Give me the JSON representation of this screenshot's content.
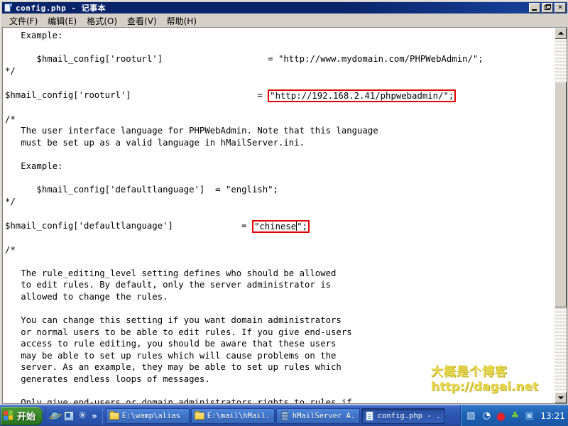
{
  "window": {
    "title": "config.php - 记事本",
    "icon": "notepad-document-icon",
    "minimize_label": "",
    "maximize_label": "",
    "close_label": "✕"
  },
  "menu": {
    "items": [
      {
        "label": "文件(F)",
        "name": "menu-file"
      },
      {
        "label": "编辑(E)",
        "name": "menu-edit"
      },
      {
        "label": "格式(O)",
        "name": "menu-format"
      },
      {
        "label": "查看(V)",
        "name": "menu-view"
      },
      {
        "label": "帮助(H)",
        "name": "menu-help"
      }
    ]
  },
  "editor": {
    "segment_1": "   Example:\n\n      $hmail_config['rooturl']                    = \"http://www.mydomain.com/PHPWebAdmin/\";\n*/\n\n$hmail_config['rooturl']                        = ",
    "highlight_1": "\"http://192.168.2.41/phpwebadmin/\";",
    "segment_2": "\n\n/*\n   The user interface language for PHPWebAdmin. Note that this language\n   must be set up as a valid language in hMailServer.ini.\n\n   Example:\n\n      $hmail_config['defaultlanguage']  = \"english\";\n*/\n\n$hmail_config['defaultlanguage']             = ",
    "highlight_2_a": "\"chinese",
    "highlight_2_b": "\";",
    "segment_3": "\n\n/*\n\n   The rule_editing_level setting defines who should be allowed\n   to edit rules. By default, only the server administrator is\n   allowed to change the rules.\n\n   You can change this setting if you want domain administrators\n   or normal users to be able to edit rules. If you give end-users\n   access to rule editing, you should be aware that these users\n   may be able to set up rules which will cause problems on the\n   server. As an example, they may be able to set up rules which\n   generates endless loops of messages.\n\n   Only give end-users or domain administrators rights to rules if",
    "highlight_color": "#e00000"
  },
  "watermark": {
    "line1": "大概是个博客",
    "line2": "http://dagai.net",
    "color": "#e8d84a"
  },
  "scrollbar": {
    "up_arrow": "▲",
    "down_arrow": "▼"
  },
  "taskbar": {
    "start_label": "开始",
    "quick_launch": [
      {
        "name": "ql-internet-explorer-icon",
        "icon": "internet-explorer-icon"
      },
      {
        "name": "ql-show-desktop-icon",
        "icon": "show-desktop-icon"
      },
      {
        "name": "ql-media-player-icon",
        "icon": "media-player-icon"
      }
    ],
    "quick_launch_chevron": "»",
    "tasks": [
      {
        "label": "E:\\wamp\\alias",
        "icon": "folder-icon",
        "active": false,
        "name": "taskbar-button-wamp-alias"
      },
      {
        "label": "E:\\mail\\hMail...",
        "icon": "folder-icon",
        "active": false,
        "name": "taskbar-button-mail-hmail"
      },
      {
        "label": "hMailServer A...",
        "icon": "server-icon",
        "active": false,
        "name": "taskbar-button-hmailserver-admin"
      },
      {
        "label": "config.php - ...",
        "icon": "notepad-document-icon",
        "active": true,
        "name": "taskbar-button-config-php"
      }
    ],
    "tray": {
      "icons": [
        {
          "name": "tray-network-icon",
          "glyph": "▨",
          "color": "#d8e4f0"
        },
        {
          "name": "tray-sound-icon",
          "glyph": "◔",
          "color": "#ffffff"
        },
        {
          "name": "tray-opera-icon",
          "glyph": "●",
          "color": "#e8202a"
        },
        {
          "name": "tray-update-icon",
          "glyph": "♣",
          "color": "#7ac43a"
        },
        {
          "name": "tray-app-icon",
          "glyph": "▣",
          "color": "#9ecbf0"
        }
      ],
      "clock": "13:21"
    }
  }
}
